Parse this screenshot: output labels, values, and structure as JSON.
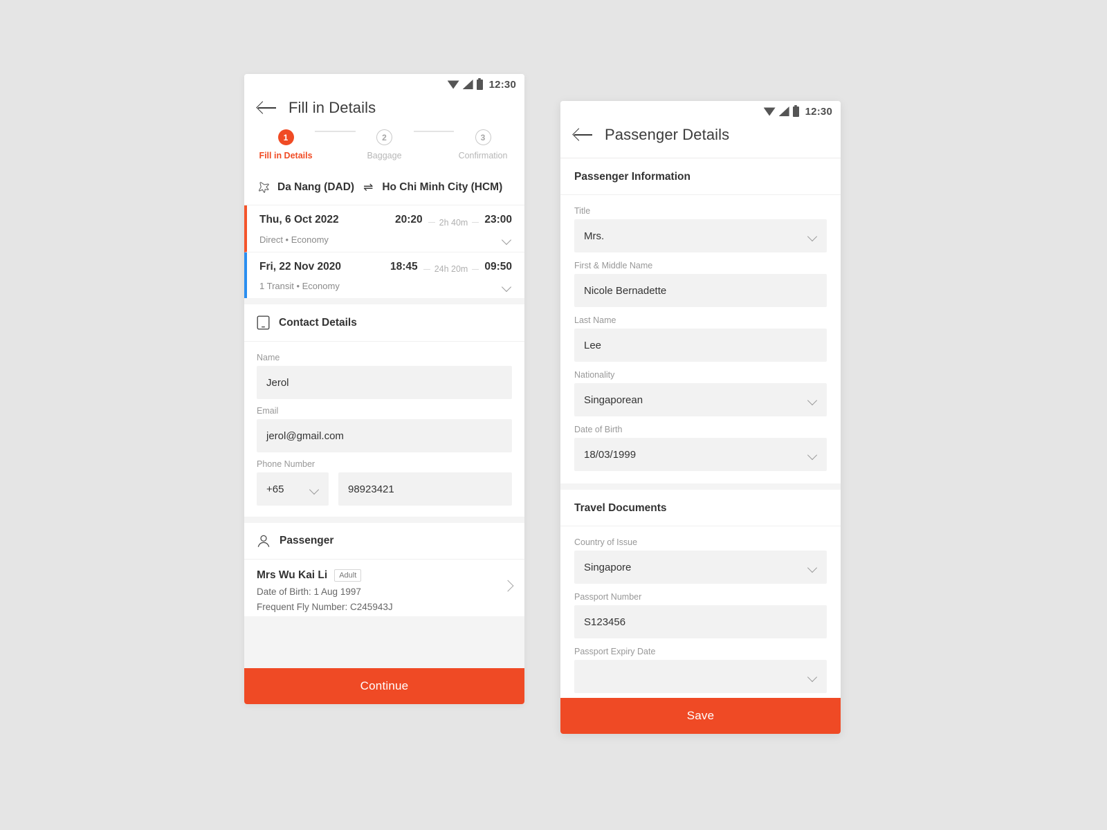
{
  "status_bar": {
    "time": "12:30",
    "icons": [
      "wifi-icon",
      "signal-icon",
      "battery-icon"
    ]
  },
  "theme": {
    "accent": "#ef4a25",
    "outbound_marker": "#f4552b",
    "return_marker": "#2a8ef0",
    "page_bg": "#e5e5e5",
    "field_bg": "#f2f2f2"
  },
  "left_screen": {
    "title": "Fill in Details",
    "back_icon": "back-arrow-icon",
    "stepper": {
      "steps": [
        {
          "number": "1",
          "label": "Fill in Details",
          "state": "active"
        },
        {
          "number": "2",
          "label": "Baggage",
          "state": "idle"
        },
        {
          "number": "3",
          "label": "Confirmation",
          "state": "idle"
        }
      ]
    },
    "flight": {
      "origin": "Da Nang (DAD)",
      "swap_icon": "⇌",
      "destination": "Ho Chi Minh City (HCM)",
      "segments": [
        {
          "date": "Thu, 6 Oct 2022",
          "depart": "20:20",
          "duration": "2h 40m",
          "arrive": "23:00",
          "meta": "Direct • Economy",
          "marker": "#f4552b"
        },
        {
          "date": "Fri, 22 Nov 2020",
          "depart": "18:45",
          "duration": "24h 20m",
          "arrive": "09:50",
          "meta": "1 Transit • Economy",
          "marker": "#2a8ef0"
        }
      ]
    },
    "contact": {
      "icon": "mobile-phone-icon",
      "title": "Contact Details",
      "name": {
        "label": "Name",
        "value": "Jerol"
      },
      "email": {
        "label": "Email",
        "value": "jerol@gmail.com"
      },
      "phone": {
        "label": "Phone Number",
        "country_code": "+65",
        "number": "98923421"
      }
    },
    "passenger": {
      "icon": "person-icon",
      "title": "Passenger",
      "entries": [
        {
          "name": "Mrs Wu Kai Li",
          "badge": "Adult",
          "dob": "Date of Birth: 1 Aug 1997",
          "frequent_flyer": "Frequent Fly Number: C245943J"
        }
      ]
    },
    "cta_label": "Continue"
  },
  "right_screen": {
    "title": "Passenger Details",
    "back_icon": "back-arrow-icon",
    "passenger_information": {
      "title": "Passenger Information",
      "fields": [
        {
          "label": "Title",
          "value": "Mrs.",
          "type": "select"
        },
        {
          "label": "First & Middle Name",
          "value": "Nicole Bernadette",
          "type": "text"
        },
        {
          "label": "Last Name",
          "value": "Lee",
          "type": "text"
        },
        {
          "label": "Nationality",
          "value": "Singaporean",
          "type": "select"
        },
        {
          "label": "Date of Birth",
          "value": "18/03/1999",
          "type": "select"
        }
      ]
    },
    "travel_documents": {
      "title": "Travel Documents",
      "fields": [
        {
          "label": "Country of Issue",
          "value": "Singapore",
          "type": "select"
        },
        {
          "label": "Passport Number",
          "value": "S123456",
          "type": "text"
        },
        {
          "label": "Passport Expiry Date",
          "value": "",
          "type": "select"
        }
      ]
    },
    "cta_label": "Save"
  }
}
